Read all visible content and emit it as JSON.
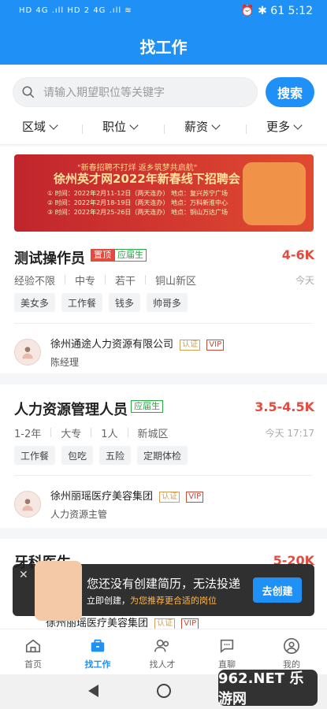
{
  "status_bar": {
    "left": "HD 4G .ıll HD 2 4G .ıll  ≋",
    "right": "⏰  ✱  61  5:12"
  },
  "header": {
    "title": "找工作"
  },
  "search": {
    "placeholder": "请输入期望职位等关键字",
    "button": "搜索"
  },
  "filters": [
    {
      "label": "区域"
    },
    {
      "label": "职位"
    },
    {
      "label": "薪资"
    },
    {
      "label": "更多"
    }
  ],
  "banner": {
    "line1": "\"新春招聘不打烊 返乡筑梦共启航\"",
    "line2": "徐州英才网2022年新春线下招聘会",
    "line3": "① 时间：2022年2月11-12日（两天连办） 地点：复兴苏宁广场\n② 时间：2022年2月18-19日（两天连办） 地点：万科新淮中心\n③ 时间：2022年2月25-26日（两天连办） 地点：铜山万达广场"
  },
  "jobs": [
    {
      "title": "测试操作员",
      "badges": [
        "置顶",
        "应届生"
      ],
      "salary": "4-6K",
      "meta": [
        "经验不限",
        "中专",
        "若干",
        "铜山新区"
      ],
      "time": "今天",
      "tags": [
        "美女多",
        "工作餐",
        "钱多",
        "帅哥多"
      ],
      "company": "徐州通途人力资源有限公司",
      "company_badges": [
        "认证",
        "VIP"
      ],
      "contact": "陈经理"
    },
    {
      "title": "人力资源管理人员",
      "badges": [
        "应届生"
      ],
      "salary": "3.5-4.5K",
      "meta": [
        "1-2年",
        "大专",
        "1人",
        "新城区"
      ],
      "time": "今天 17:17",
      "tags": [
        "工作餐",
        "包吃",
        "五险",
        "定期体检"
      ],
      "company": "徐州丽瑶医疗美容集团",
      "company_badges": [
        "认证",
        "VIP"
      ],
      "contact": "人力资源主管"
    },
    {
      "title": "牙科医生",
      "salary": "5-20K",
      "company": "徐州丽瑶医疗美容集团",
      "company_badges": [
        "认证",
        "VIP"
      ]
    }
  ],
  "toast": {
    "title": "您还没有创建简历，无法投递",
    "prefix": "立即创建，",
    "highlight": "为您推荐更合适的岗位",
    "button": "去创建",
    "close_icon": "close-icon"
  },
  "tabs": [
    {
      "label": "首页",
      "icon": "home-icon"
    },
    {
      "label": "找工作",
      "icon": "briefcase-icon"
    },
    {
      "label": "找人才",
      "icon": "people-icon"
    },
    {
      "label": "直聊",
      "icon": "chat-icon"
    },
    {
      "label": "我的",
      "icon": "profile-icon"
    }
  ],
  "watermark": "962.NET 乐游网",
  "colors": {
    "brand": "#1e90f6",
    "salary": "#e44b3d",
    "green": "#28a745"
  }
}
